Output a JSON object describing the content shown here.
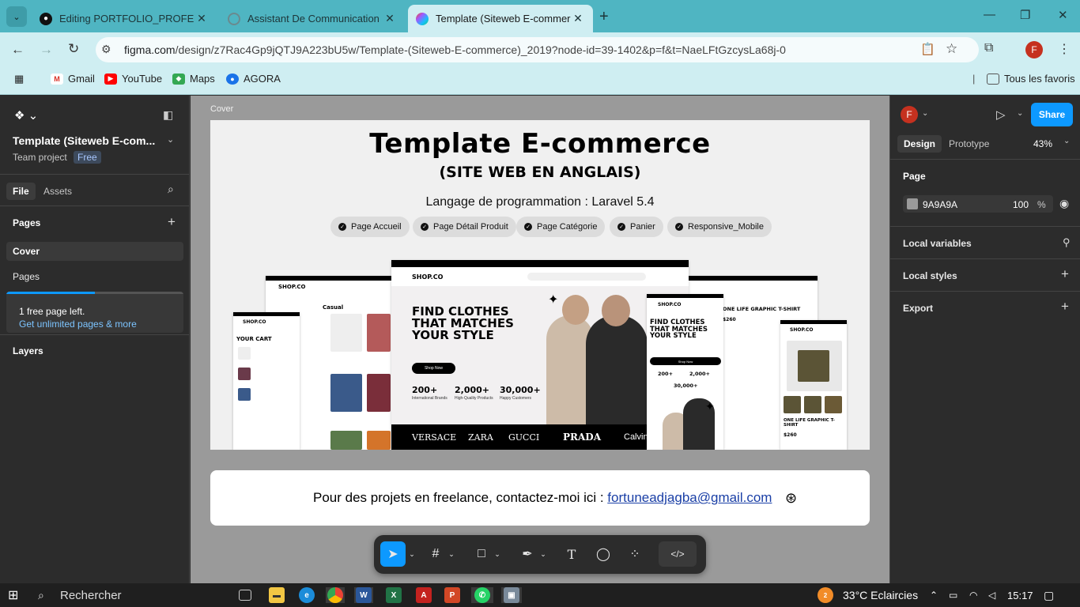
{
  "browser": {
    "tabs": [
      {
        "title": "Editing PORTFOLIO_PROFESSIO",
        "icon": "github-icon"
      },
      {
        "title": "Assistant De Communication Pr",
        "icon": "globe-icon"
      },
      {
        "title": "Template (Siteweb E-commerce",
        "icon": "figma-icon",
        "active": true
      }
    ],
    "url_host": "figma.com",
    "url_path": "/design/z7Rac4Gp9jQTJ9A223bU5w/Template-(Siteweb-E-commerce)_2019?node-id=39-1402&p=f&t=NaeLFtGzcysLa68j-0",
    "bookmarks": [
      "Gmail",
      "YouTube",
      "Maps",
      "AGORA"
    ],
    "all_bookmarks": "Tous les favoris",
    "profile_initial": "F"
  },
  "left_panel": {
    "file_name": "Template (Siteweb E-com...",
    "team": "Team project",
    "plan_badge": "Free",
    "tabs": [
      "File",
      "Assets"
    ],
    "pages_heading": "Pages",
    "pages": [
      "Cover",
      "Pages"
    ],
    "free_pages": "1 free page left.",
    "upgrade_link": "Get unlimited pages & more",
    "free_pages_progress": 0.5,
    "layers_heading": "Layers"
  },
  "canvas": {
    "frame_label": "Cover",
    "cover": {
      "title": "Template E-commerce",
      "subtitle": "(SITE WEB EN ANGLAIS)",
      "language": "Langage de programmation : Laravel 5.4",
      "pills": [
        "Page Accueil",
        "Page Détail Produit",
        "Page Catégorie",
        "Panier",
        "Responsive_Mobile"
      ]
    },
    "mockup": {
      "logo": "SHOP.CO",
      "hero": "FIND CLOTHES THAT MATCHES YOUR STYLE",
      "shop_now": "Shop Now",
      "stats": [
        {
          "value": "200+",
          "label": "International Brands"
        },
        {
          "value": "2,000+",
          "label": "High-Quality Products"
        },
        {
          "value": "30,000+",
          "label": "Happy Customers"
        }
      ],
      "brands": [
        "VERSACE",
        "ZARA",
        "GUCCI",
        "PRADA",
        "Calvin"
      ],
      "cart_title": "YOUR CART",
      "category_title": "Casual",
      "product_title": "ONE LIFE GRAPHIC T-SHIRT",
      "price": "$260"
    },
    "contact_text": "Pour des projets en freelance, contactez-moi ici : ",
    "contact_email": "fortuneadjagba@gmail.com"
  },
  "right_panel": {
    "tabs": [
      "Design",
      "Prototype"
    ],
    "zoom": "43%",
    "share": "Share",
    "page_heading": "Page",
    "page_color": "9A9A9A",
    "page_opacity": "100",
    "percent": "%",
    "sections": [
      "Local variables",
      "Local styles",
      "Export"
    ]
  },
  "taskbar": {
    "search": "Rechercher",
    "weather": "33°C  Eclaircies",
    "time": "15:17",
    "notification_count": "2"
  },
  "colors": {
    "tab_bar": "#4fb5c2",
    "toolbar": "#cfeef2",
    "figma_panel": "#2c2c2c",
    "canvas": "#9a9a9a",
    "accent": "#0d99ff"
  }
}
